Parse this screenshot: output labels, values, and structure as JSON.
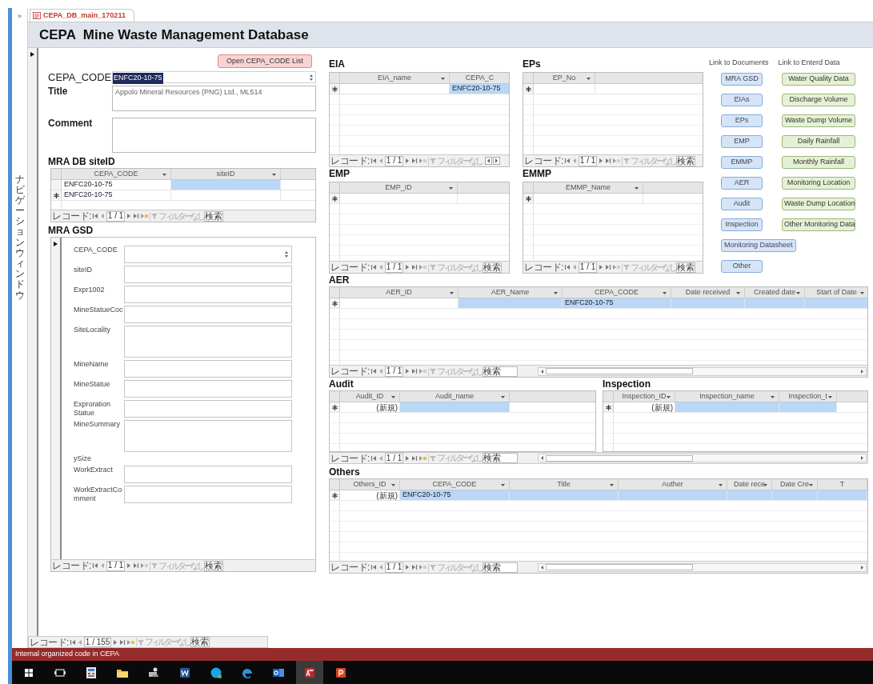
{
  "nav_pane": {
    "toggle": "»",
    "label": "ナビゲーションウィンドウ"
  },
  "document_tab": {
    "title": "CEPA_DB_main_170211"
  },
  "form_title": "CEPA  Mine Waste Management Database",
  "open_list_button": "Open CEPA_CODE List",
  "fields": [
    {
      "label": "CEPA_CODE",
      "kind": "combo",
      "value": "ENFC20-10-75",
      "highlighted": true
    },
    {
      "label": "Title",
      "kind": "text",
      "value": "Appolo Mineral Resources (PNG) Ltd., ML514",
      "highlighted": false
    },
    {
      "label": "Comment",
      "kind": "memo"
    }
  ],
  "site_id": {
    "heading": "MRA DB siteID",
    "columns": [
      {
        "name": "CEPA_CODE",
        "dropdown": true
      },
      {
        "name": "siteID",
        "dropdown": true
      }
    ],
    "rows": [
      {
        "new_record": false,
        "cells": [
          {
            "text": "ENFC20-10-75",
            "kind": "value",
            "highlighted": false
          },
          {
            "highlighted": true
          }
        ]
      },
      {
        "new_record": true,
        "cells": [
          {
            "text": "ENFC20-10-75",
            "kind": "value",
            "highlighted": false
          },
          {
            "highlighted": false
          }
        ]
      }
    ],
    "nav": {
      "label": "レコード:",
      "position": "1 / 1",
      "new_enabled": true,
      "filter": "フィルターなし",
      "search": "検索"
    }
  },
  "gsd": {
    "heading": "MRA GSD",
    "fields": [
      {
        "label": "CEPA_CODE",
        "kind": "combo"
      },
      {
        "label": "siteID",
        "kind": "text"
      },
      {
        "label": "Expr1002",
        "kind": "text"
      },
      {
        "label": "MineStatueCoc",
        "kind": "text"
      },
      {
        "label": "SiteLocality",
        "kind": "memo"
      },
      {
        "label": "MineName",
        "kind": "text"
      },
      {
        "label": "MineStatue",
        "kind": "text"
      },
      {
        "label": "Exproration Statue",
        "kind": "text"
      },
      {
        "label": "MineSummary",
        "kind": "memo"
      },
      {
        "label": "ySize",
        "kind": "label"
      },
      {
        "label": "WorkExtract",
        "kind": "text"
      },
      {
        "label": "WorkExtractComment",
        "kind": "text"
      }
    ],
    "nav": {
      "label": "レコード:",
      "position": "1 / 1",
      "new_enabled": false,
      "filter": "フィルターなし",
      "search": "検索"
    }
  },
  "eia": {
    "heading": "EIA",
    "columns": [
      {
        "name": "EIA_name",
        "dropdown": true
      },
      {
        "name": "CEPA_C",
        "dropdown": false
      }
    ],
    "rows": [
      {
        "new_record": true,
        "cells": [
          {
            "highlighted": false
          },
          {
            "text": "ENFC20-10-75",
            "kind": "value",
            "highlighted": true
          }
        ]
      }
    ],
    "nav": {
      "label": "レコード:",
      "position": "1 / 1",
      "new_enabled": false,
      "filter": "フィルターなし"
    }
  },
  "eps": {
    "heading": "EPs",
    "columns": [
      {
        "name": "EP_No",
        "dropdown": true
      }
    ],
    "rows": [
      {
        "new_record": true,
        "cells": [
          {
            "highlighted": false
          }
        ]
      }
    ],
    "nav": {
      "label": "レコード:",
      "position": "1 / 1",
      "new_enabled": false,
      "filter": "フィルターなし",
      "search": "検索"
    }
  },
  "emp": {
    "heading": "EMP",
    "columns": [
      {
        "name": "EMP_ID",
        "dropdown": true
      }
    ],
    "rows": [
      {
        "new_record": true,
        "cells": [
          {
            "highlighted": false
          }
        ]
      }
    ],
    "nav": {
      "label": "レコード:",
      "position": "1 / 1",
      "new_enabled": false,
      "filter": "フィルターなし",
      "search": "検索"
    }
  },
  "emmp": {
    "heading": "EMMP",
    "columns": [
      {
        "name": "EMMP_Name",
        "dropdown": true
      }
    ],
    "rows": [
      {
        "new_record": true,
        "cells": [
          {
            "highlighted": false
          }
        ]
      }
    ],
    "nav": {
      "label": "レコード:",
      "position": "1 / 1",
      "new_enabled": false,
      "filter": "フィルターなし",
      "search": "検索"
    }
  },
  "document_links": {
    "heading": "Link to Documents",
    "buttons": [
      "MRA GSD",
      "EIAs",
      "EPs",
      "EMP",
      "EMMP",
      "AER",
      "Audit",
      "Inspection",
      "Monitoring Datasheet",
      "Other"
    ]
  },
  "data_links": {
    "heading": "Link to Enterd Data",
    "buttons": [
      "Water Quality Data",
      "Discharge Volume",
      "Waste Dump Volume",
      "Daily Rainfall",
      "Monthly Rainfall",
      "Monitoring Location",
      "Waste Dump Location",
      "Other Monitoring Data"
    ]
  },
  "aer": {
    "heading": "AER",
    "columns": [
      {
        "name": "AER_ID",
        "dropdown": true
      },
      {
        "name": "AER_Name",
        "dropdown": true
      },
      {
        "name": "CEPA_CODE",
        "dropdown": true
      },
      {
        "name": "Date received",
        "dropdown": true
      },
      {
        "name": "Created date",
        "dropdown": true
      },
      {
        "name": "Start of Date",
        "dropdown": true
      }
    ],
    "rows": [
      {
        "new_record": true,
        "cells": [
          {
            "highlighted": false
          },
          {
            "highlighted": true
          },
          {
            "text": "ENFC20-10-75",
            "kind": "value",
            "highlighted": true
          },
          {
            "highlighted": true
          },
          {
            "highlighted": true
          },
          {
            "highlighted": true
          }
        ]
      }
    ],
    "nav": {
      "label": "レコード:",
      "position": "1 / 1",
      "new_enabled": false,
      "filter": "フィルターなし",
      "search": "検索"
    }
  },
  "audit": {
    "heading": "Audit",
    "columns": [
      {
        "name": "Audit_ID",
        "dropdown": true
      },
      {
        "name": "Audit_name",
        "dropdown": true
      }
    ],
    "rows": [
      {
        "new_record": true,
        "cells": [
          {
            "text": "(新規)",
            "kind": "placeholder",
            "highlighted": false
          },
          {
            "highlighted": true
          }
        ]
      }
    ]
  },
  "inspection": {
    "heading": "Inspection",
    "columns": [
      {
        "name": "Inspection_ID",
        "dropdown": true
      },
      {
        "name": "Inspection_name",
        "dropdown": true
      },
      {
        "name": "Inspection_t",
        "dropdown": true
      }
    ],
    "rows": [
      {
        "new_record": true,
        "cells": [
          {
            "text": "(新規)",
            "kind": "placeholder",
            "highlighted": false
          },
          {
            "highlighted": true
          },
          {
            "highlighted": true
          }
        ]
      }
    ]
  },
  "audit_inspection_nav": {
    "label": "レコード:",
    "position": "1 / 1",
    "new_enabled": true,
    "filter": "フィルターなし",
    "search": "検索"
  },
  "others": {
    "heading": "Others",
    "columns": [
      {
        "name": "Others_ID",
        "dropdown": true
      },
      {
        "name": "CEPA_CODE",
        "dropdown": true
      },
      {
        "name": "Title",
        "dropdown": true
      },
      {
        "name": "Auther",
        "dropdown": true
      },
      {
        "name": "Date rece",
        "dropdown": true
      },
      {
        "name": "Date Cre",
        "dropdown": true
      },
      {
        "name": "T",
        "dropdown": false
      }
    ],
    "rows": [
      {
        "new_record": true,
        "cells": [
          {
            "text": "(新規)",
            "kind": "placeholder",
            "highlighted": false
          },
          {
            "text": "ENFC20-10-75",
            "kind": "value",
            "highlighted": true
          },
          {
            "highlighted": true
          },
          {
            "highlighted": true
          },
          {
            "highlighted": true
          },
          {
            "highlighted": true
          },
          {
            "highlighted": true
          }
        ]
      }
    ],
    "nav": {
      "label": "レコード:",
      "position": "1 / 1",
      "new_enabled": false,
      "filter": "フィルターなし",
      "search": "検索"
    }
  },
  "record_nav": {
    "label": "レコード:",
    "position": "1 / 155",
    "new_enabled": true,
    "filter": "フィルターなし",
    "search": "検索"
  },
  "status_bar": "Internal organized code in CEPA",
  "taskbar": [
    {
      "kind": "start",
      "active": false
    },
    {
      "kind": "task_view",
      "active": false
    },
    {
      "kind": "calculator",
      "active": false
    },
    {
      "kind": "folder",
      "active": false
    },
    {
      "kind": "network",
      "active": false
    },
    {
      "kind": "word",
      "active": false
    },
    {
      "kind": "skype",
      "active": false
    },
    {
      "kind": "edge",
      "active": false
    },
    {
      "kind": "outlook",
      "active": false
    },
    {
      "kind": "access",
      "active": true
    },
    {
      "kind": "powerpoint",
      "active": false
    }
  ]
}
